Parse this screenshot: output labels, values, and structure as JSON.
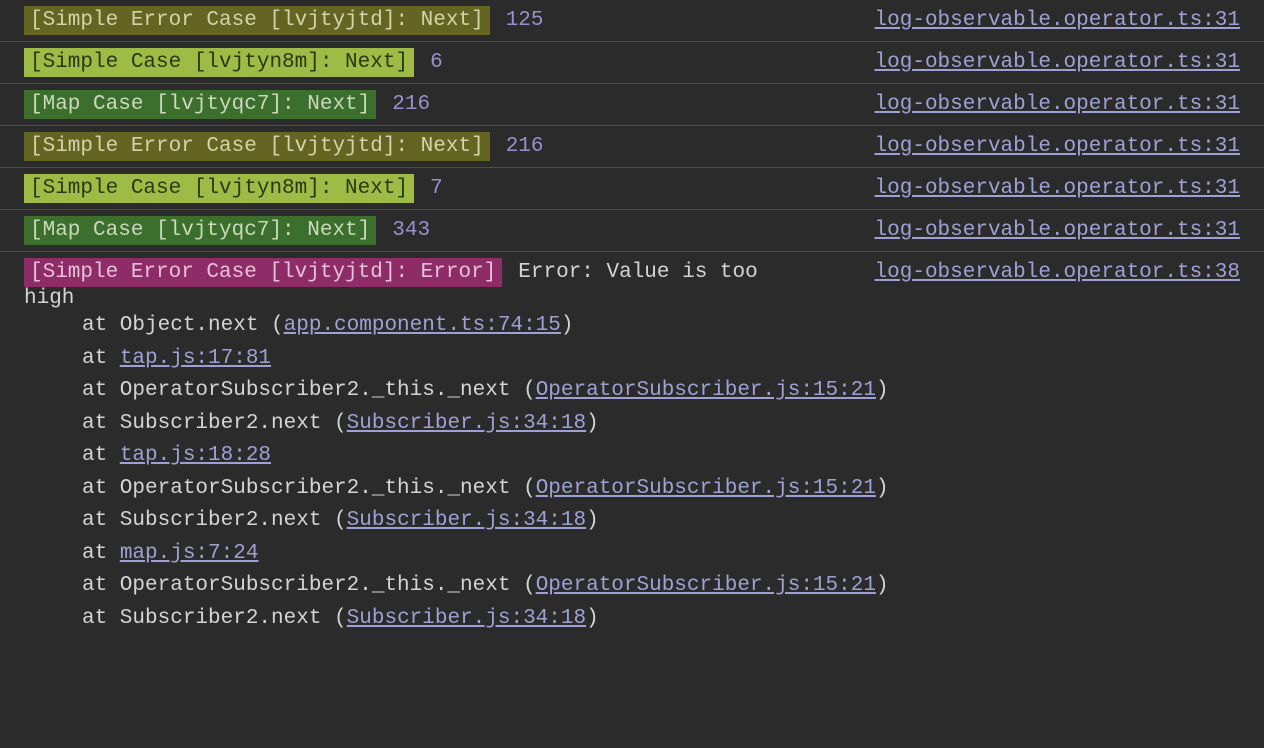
{
  "logs": [
    {
      "badgeClass": "badge-olive",
      "badge": "[Simple Error Case [lvjtyjtd]: Next]",
      "value": "125",
      "source": "log-observable.operator.ts:31"
    },
    {
      "badgeClass": "badge-lime",
      "badge": "[Simple Case [lvjtyn8m]: Next]",
      "value": "6",
      "source": "log-observable.operator.ts:31"
    },
    {
      "badgeClass": "badge-green",
      "badge": "[Map Case [lvjtyqc7]: Next]",
      "value": "216",
      "source": "log-observable.operator.ts:31"
    },
    {
      "badgeClass": "badge-olive",
      "badge": "[Simple Error Case [lvjtyjtd]: Next]",
      "value": "216",
      "source": "log-observable.operator.ts:31"
    },
    {
      "badgeClass": "badge-lime",
      "badge": "[Simple Case [lvjtyn8m]: Next]",
      "value": "7",
      "source": "log-observable.operator.ts:31"
    },
    {
      "badgeClass": "badge-green",
      "badge": "[Map Case [lvjtyqc7]: Next]",
      "value": "343",
      "source": "log-observable.operator.ts:31"
    }
  ],
  "error": {
    "badge": "[Simple Error Case [lvjtyjtd]: Error]",
    "message_part1": "Error: Value is too",
    "message_part2": "high",
    "source": "log-observable.operator.ts:38",
    "stack": [
      {
        "prefix": "at Object.next (",
        "link": "app.component.ts:74:15",
        "suffix": ")"
      },
      {
        "prefix": "at ",
        "link": "tap.js:17:81",
        "suffix": ""
      },
      {
        "prefix": "at OperatorSubscriber2._this._next (",
        "link": "OperatorSubscriber.js:15:21",
        "suffix": ")"
      },
      {
        "prefix": "at Subscriber2.next (",
        "link": "Subscriber.js:34:18",
        "suffix": ")"
      },
      {
        "prefix": "at ",
        "link": "tap.js:18:28",
        "suffix": ""
      },
      {
        "prefix": "at OperatorSubscriber2._this._next (",
        "link": "OperatorSubscriber.js:15:21",
        "suffix": ")"
      },
      {
        "prefix": "at Subscriber2.next (",
        "link": "Subscriber.js:34:18",
        "suffix": ")"
      },
      {
        "prefix": "at ",
        "link": "map.js:7:24",
        "suffix": ""
      },
      {
        "prefix": "at OperatorSubscriber2._this._next (",
        "link": "OperatorSubscriber.js:15:21",
        "suffix": ")"
      },
      {
        "prefix": "at Subscriber2.next (",
        "link": "Subscriber.js:34:18",
        "suffix": ")"
      }
    ]
  }
}
